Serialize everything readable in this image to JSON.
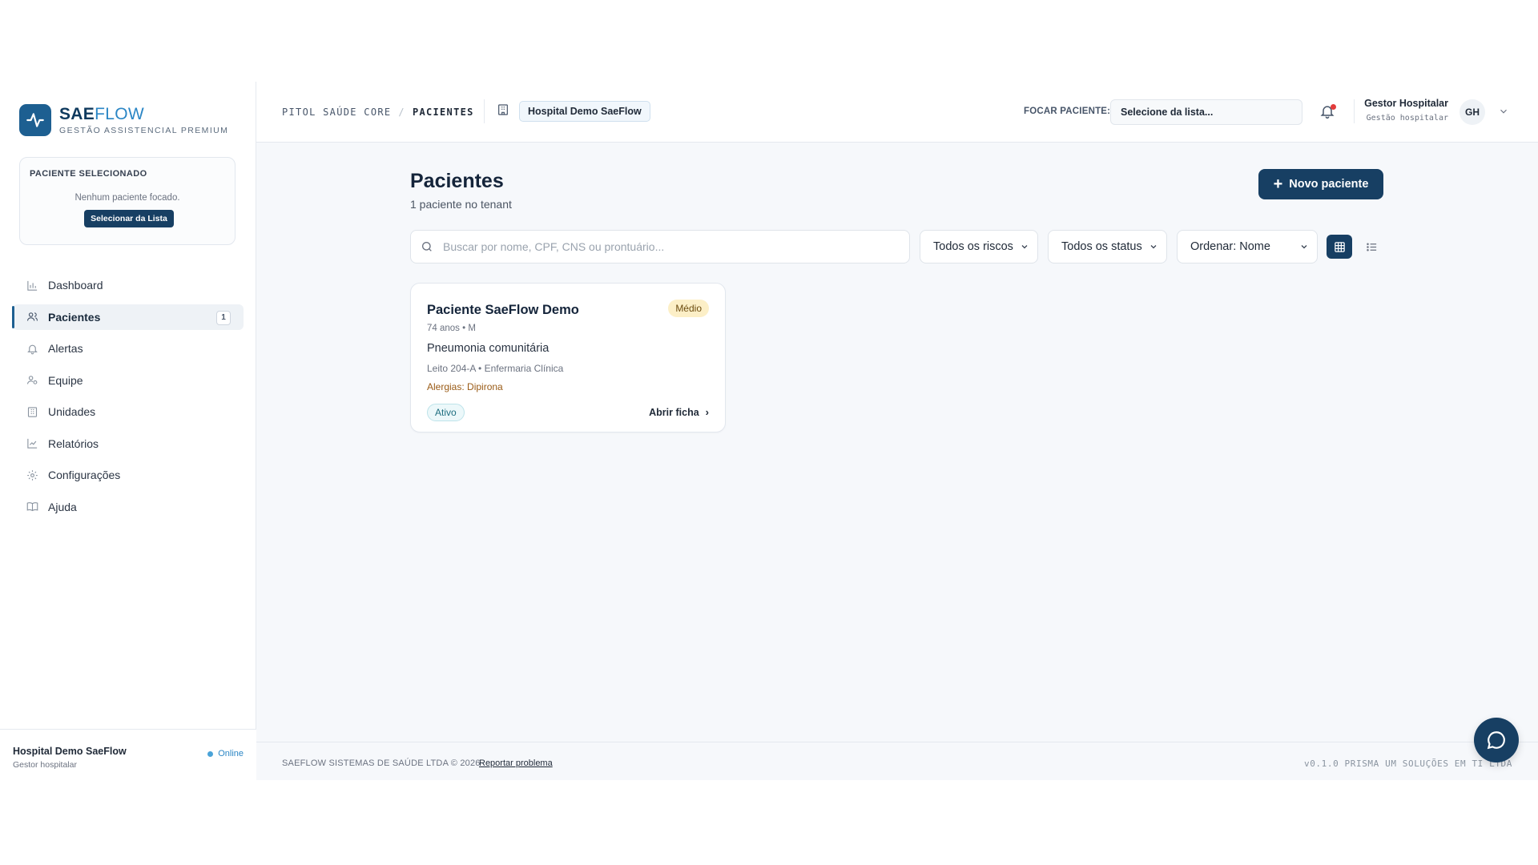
{
  "brand": {
    "name_primary": "SAE",
    "name_accent": "FLOW",
    "subtitle": "GESTÃO ASSISTENCIAL PREMIUM",
    "color": "#1d5f91"
  },
  "selected_patient": {
    "title": "PACIENTE SELECIONADO",
    "empty_text": "Nenhum paciente focado.",
    "button_label": "Selecionar da Lista"
  },
  "sidebar": {
    "items": [
      {
        "label": "Dashboard",
        "icon": "bar-chart-icon",
        "active": false
      },
      {
        "label": "Pacientes",
        "icon": "users-icon",
        "active": true,
        "badge": "1"
      },
      {
        "label": "Alertas",
        "icon": "bell-icon",
        "active": false
      },
      {
        "label": "Equipe",
        "icon": "team-icon",
        "active": false
      },
      {
        "label": "Unidades",
        "icon": "building-icon",
        "active": false
      },
      {
        "label": "Relatórios",
        "icon": "line-chart-icon",
        "active": false
      },
      {
        "label": "Configurações",
        "icon": "gear-icon",
        "active": false
      },
      {
        "label": "Ajuda",
        "icon": "book-icon",
        "active": false
      }
    ],
    "footer": {
      "hospital": "Hospital Demo SaeFlow",
      "role": "Gestor hospitalar",
      "status": "Online"
    }
  },
  "header": {
    "breadcrumb": [
      "PITOL SAÚDE CORE",
      "PACIENTES"
    ],
    "breadcrumb_separator": "/",
    "hospital_chip": "Hospital Demo SaeFlow",
    "focus_label": "FOCAR PACIENTE:",
    "focus_select_value": "Selecione da lista...",
    "user_name": "Gestor Hospitalar",
    "user_role": "Gestão hospitalar",
    "avatar_initials": "GH"
  },
  "main": {
    "title": "Pacientes",
    "subtitle": "1 paciente no tenant",
    "new_button_label": "Novo paciente",
    "search_placeholder": "Buscar por nome, CPF, CNS ou prontuário...",
    "filters": {
      "risk": "Todos os riscos",
      "status": "Todos os status",
      "sort": "Ordenar: Nome"
    },
    "view_mode": "grid"
  },
  "patients": [
    {
      "name": "Paciente SaeFlow Demo",
      "risk": "Médio",
      "meta": "74 anos • M",
      "diagnosis": "Pneumonia comunitária",
      "bed": "Leito 204-A • Enfermaria Clínica",
      "allergies": "Alergias: Dipirona",
      "status": "Ativo",
      "open_label": "Abrir ficha"
    }
  ],
  "footer": {
    "copyright": "SAEFLOW SISTEMAS DE SAÚDE LTDA © 2026",
    "report_link": "Reportar problema",
    "version": "v0.1.0  PRISMA UM SOLUÇÕES EM TI LTDA"
  }
}
